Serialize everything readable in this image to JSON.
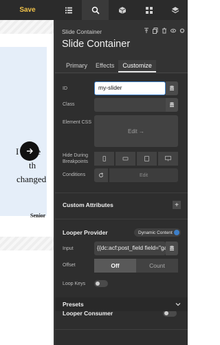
{
  "toolbar": {
    "save_label": "Save",
    "icons": [
      "list-icon",
      "search-icon",
      "cube-icon",
      "grid-icon",
      "layers-icon"
    ],
    "active_icon": "search-icon"
  },
  "canvas": {
    "slide_lines": [
      "I ",
      " be",
      "th",
      "changed"
    ],
    "slide_role": "Senior",
    "arrow_icon": "arrow-right-icon"
  },
  "panel": {
    "element_type": "Slide Container",
    "title": "Slide Container",
    "tabs": [
      "Primary",
      "Effects",
      "Customize"
    ],
    "active_tab": "Customize",
    "fields": {
      "id_label": "ID",
      "id_value": "my-slider",
      "class_label": "Class",
      "class_value": "",
      "element_css_label": "Element CSS",
      "element_css_button": "Edit →",
      "hide_breakpoints_label": "Hide During Breakpoints",
      "conditions_label": "Conditions",
      "conditions_button": "Edit"
    },
    "custom_attributes": {
      "title": "Custom Attributes",
      "add_label": "+"
    },
    "looper_provider": {
      "title": "Looper Provider",
      "badge": "Dynamic Content",
      "input_label": "Input",
      "input_value": "{{dc:acf:post_field field=\"gal",
      "offset_label": "Offset",
      "offset_options": [
        "Off",
        "Count"
      ],
      "offset_selected": "Off",
      "loop_keys_label": "Loop Keys"
    },
    "looper_consumer": {
      "title": "Looper Consumer"
    },
    "presets": {
      "title": "Presets"
    }
  },
  "colors": {
    "accent": "#3d7fc9",
    "save": "#f0c24a",
    "panel_bg": "#333333"
  }
}
